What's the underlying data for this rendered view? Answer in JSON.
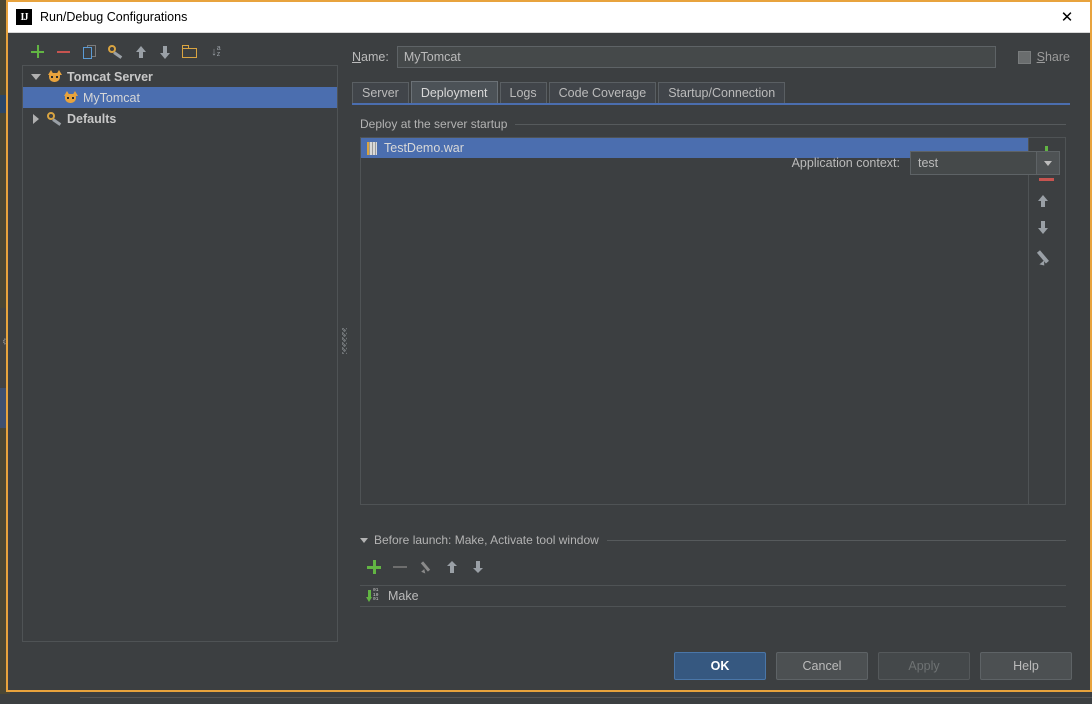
{
  "window": {
    "title": "Run/Debug Configurations",
    "app_icon": "intellij-idea-icon",
    "close_icon": "close-icon",
    "accent_border": "#e8a33d"
  },
  "tree_toolbar": {
    "buttons": [
      {
        "name": "add-configuration-button",
        "icon": "plus-icon"
      },
      {
        "name": "remove-configuration-button",
        "icon": "minus-icon"
      },
      {
        "name": "copy-configuration-button",
        "icon": "copy-icon"
      },
      {
        "name": "edit-defaults-button",
        "icon": "wrench-icon"
      },
      {
        "name": "move-up-button",
        "icon": "arrow-up-icon"
      },
      {
        "name": "move-down-button",
        "icon": "arrow-down-icon"
      },
      {
        "name": "create-folder-button",
        "icon": "folder-icon"
      },
      {
        "name": "sort-alphabetically-button",
        "icon": "sort-az-icon"
      }
    ]
  },
  "tree": {
    "nodes": [
      {
        "label": "Tomcat Server",
        "icon": "tomcat-icon",
        "level": 1,
        "expanded": true,
        "selected": false
      },
      {
        "label": "MyTomcat",
        "icon": "tomcat-icon",
        "level": 2,
        "expanded": false,
        "selected": true
      },
      {
        "label": "Defaults",
        "icon": "wrench-icon",
        "level": 1,
        "expanded": false,
        "selected": false
      }
    ]
  },
  "name_row": {
    "label": "Name:",
    "label_mnemonic": "N",
    "value": "MyTomcat",
    "share_label": "Share",
    "share_mnemonic": "S",
    "share_checked": false
  },
  "tabs": [
    {
      "label": "Server",
      "active": false
    },
    {
      "label": "Deployment",
      "active": true
    },
    {
      "label": "Logs",
      "active": false
    },
    {
      "label": "Code Coverage",
      "active": false
    },
    {
      "label": "Startup/Connection",
      "active": false
    }
  ],
  "deployment": {
    "group_title": "Deploy at the server startup",
    "artifacts": [
      {
        "name": "TestDemo.war",
        "icon": "war-archive-icon",
        "selected": true
      }
    ],
    "side_buttons": [
      {
        "name": "add-artifact-button",
        "icon": "plus-icon"
      },
      {
        "name": "remove-artifact-button",
        "icon": "minus-icon"
      },
      {
        "name": "move-artifact-up-button",
        "icon": "arrow-up-icon"
      },
      {
        "name": "move-artifact-down-button",
        "icon": "arrow-down-icon"
      },
      {
        "name": "edit-artifact-button",
        "icon": "pencil-icon"
      }
    ],
    "application_context": {
      "label": "Application context:",
      "value": "test",
      "dropdown_icon": "chevron-down-icon"
    }
  },
  "before_launch": {
    "title": "Before launch: Make, Activate tool window",
    "title_mnemonic": "B",
    "expanded": true,
    "toolbar": [
      {
        "name": "add-task-button",
        "icon": "plus-icon",
        "enabled": true
      },
      {
        "name": "remove-task-button",
        "icon": "minus-icon",
        "enabled": false
      },
      {
        "name": "edit-task-button",
        "icon": "pencil-icon",
        "enabled": false
      },
      {
        "name": "move-task-up-button",
        "icon": "arrow-up-icon",
        "enabled": false
      },
      {
        "name": "move-task-down-button",
        "icon": "arrow-down-icon",
        "enabled": false
      }
    ],
    "tasks": [
      {
        "label": "Make",
        "icon": "make-build-icon"
      }
    ]
  },
  "footer": {
    "buttons": [
      {
        "label": "OK",
        "name": "ok-button",
        "style": "default"
      },
      {
        "label": "Cancel",
        "name": "cancel-button",
        "style": "normal"
      },
      {
        "label": "Apply",
        "name": "apply-button",
        "style": "disabled"
      },
      {
        "label": "Help",
        "name": "help-button",
        "style": "normal"
      }
    ]
  }
}
